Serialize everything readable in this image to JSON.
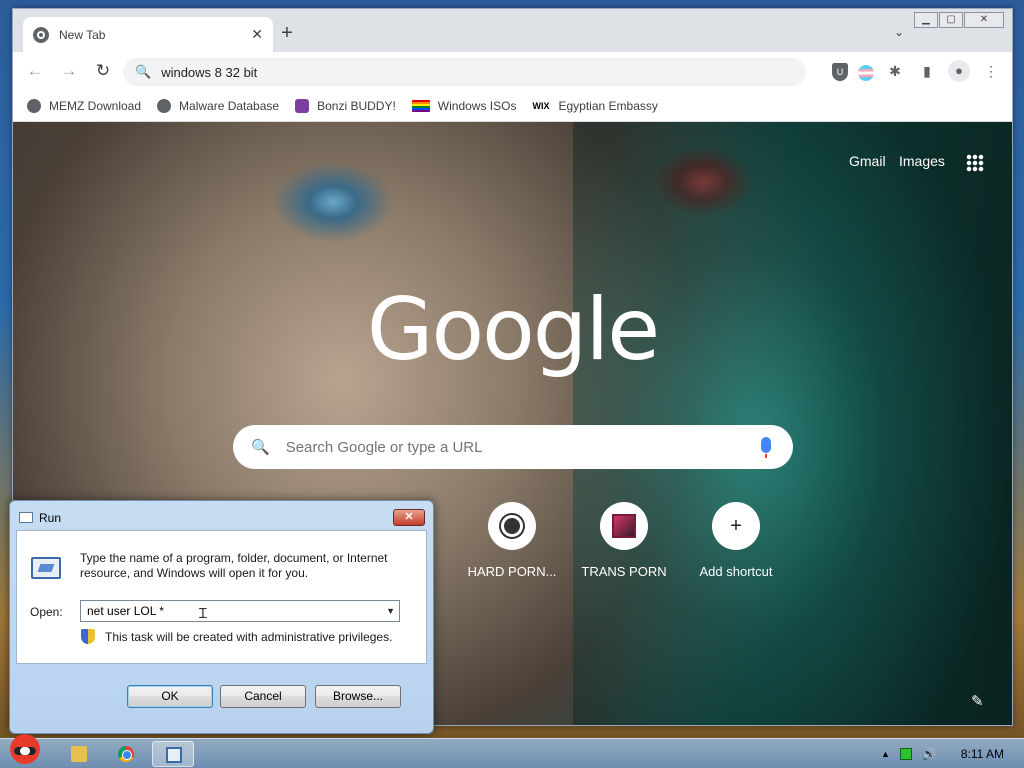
{
  "browser": {
    "tab_title": "New Tab",
    "tab_close": "✕",
    "new_tab": "+",
    "tab_search": "⌄",
    "window_controls": {
      "minimize": "▁",
      "maximize": "▢",
      "close": "✕"
    },
    "nav": {
      "back": "←",
      "forward": "→",
      "reload": "↻"
    },
    "address": "windows 8 32 bit",
    "extensions": {
      "puzzle": "✱",
      "sidepanel": "▮",
      "profile": "●",
      "menu": "⋮",
      "shield": "U"
    },
    "bookmarks": [
      {
        "label": "MEMZ Download",
        "icon": "globe-icon"
      },
      {
        "label": "Malware Database",
        "icon": "globe-icon"
      },
      {
        "label": "Bonzi BUDDY!",
        "icon": "bonzi-icon"
      },
      {
        "label": "Windows ISOs",
        "icon": "rainbow-flag-icon"
      },
      {
        "label": "Egyptian Embassy",
        "icon": "wix-icon",
        "icon_text": "WIX"
      }
    ]
  },
  "ntp": {
    "gmail": "Gmail",
    "images": "Images",
    "logo": "Google",
    "search_placeholder": "Search Google or type a URL",
    "shortcuts": [
      {
        "label": "HARD PORN..."
      },
      {
        "label": "TRANS PORN"
      },
      {
        "label": "Add shortcut",
        "glyph": "+"
      }
    ],
    "edit_icon": "✎"
  },
  "run_dialog": {
    "title": "Run",
    "close": "✕",
    "description": "Type the name of a program, folder, document, or Internet resource, and Windows will open it for you.",
    "open_label": "Open:",
    "open_value": "net user LOL *",
    "admin_note": "This task will be created with administrative privileges.",
    "ok": "OK",
    "cancel": "Cancel",
    "browse": "Browse..."
  },
  "taskbar": {
    "clock": "8:11 AM",
    "tray_up": "▲",
    "volume": "🔊"
  }
}
